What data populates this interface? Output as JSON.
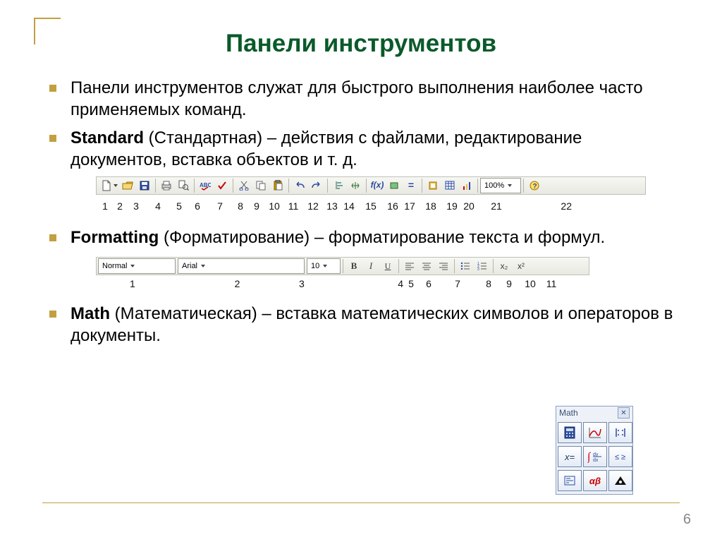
{
  "title": "Панели инструментов",
  "bullets": {
    "intro": "Панели инструментов служат для быстрого выполнения наиболее часто применяемых команд.",
    "std_label": "Standard",
    "std_text": " (Стандартная)  – действия с файлами, редактирование документов, вставка объектов и т. д.",
    "fmt_label": "Formatting",
    "fmt_text": " (Форматирование)  – форматирование текста и формул.",
    "math_label": "Math",
    "math_text": " (Математическая)  – вставка математических символов и операторов в документы."
  },
  "standard_toolbar": {
    "zoom": "100%",
    "fx": "f(x)",
    "numbers": [
      "1",
      "2",
      "3",
      "4",
      "5",
      "6",
      "7",
      "8",
      "9",
      "10",
      "11",
      "12",
      "13",
      "14",
      "15",
      "16",
      "17",
      "18",
      "19",
      "20",
      "21",
      "22"
    ]
  },
  "formatting_toolbar": {
    "style": "Normal",
    "font": "Arial",
    "size": "10",
    "b": "B",
    "i": "I",
    "u": "U",
    "x2": "x₂",
    "x2s": "x²",
    "numbers": [
      "1",
      "2",
      "3",
      "4",
      "5",
      "6",
      "7",
      "8",
      "9",
      "10",
      "11"
    ]
  },
  "math_panel": {
    "title": "Math",
    "btn_xeq": "x=",
    "btn_ab": "αβ"
  },
  "page_number": "6"
}
